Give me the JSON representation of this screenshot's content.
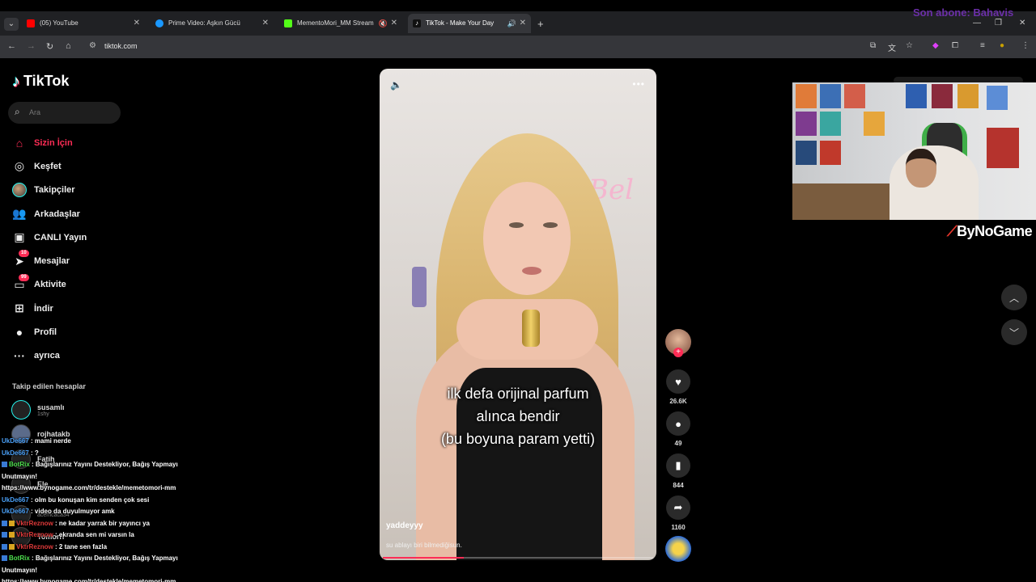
{
  "overlay": {
    "subscriber_text": "Son abone: Bahavis"
  },
  "browser": {
    "tabs": [
      {
        "title": "(05) YouTube",
        "favicon_color": "#ff0000"
      },
      {
        "title": "Prime Video: Aşkın Gücü",
        "favicon_color": "#1a98ff"
      },
      {
        "title": "MementoMori_MM Stream",
        "favicon_color": "#53fc18"
      },
      {
        "title": "TikTok - Make Your Day",
        "favicon_color": "#ffffff"
      }
    ],
    "url": "tiktok.com"
  },
  "tiktok": {
    "logo": "TikTok",
    "search_placeholder": "Ara",
    "nav": [
      {
        "label": "Sizin İçin",
        "icon": "home-icon"
      },
      {
        "label": "Keşfet",
        "icon": "compass-icon"
      },
      {
        "label": "Takipçiler",
        "icon": "avatar-icon"
      },
      {
        "label": "Arkadaşlar",
        "icon": "friends-icon"
      },
      {
        "label": "CANLI Yayın",
        "icon": "live-icon"
      },
      {
        "label": "Mesajlar",
        "icon": "messages-icon",
        "badge": "10"
      },
      {
        "label": "Aktivite",
        "icon": "activity-icon",
        "badge": "99"
      },
      {
        "label": "İndir",
        "icon": "download-icon"
      },
      {
        "label": "Profil",
        "icon": "profile-icon"
      },
      {
        "label": "ayrıca",
        "icon": "more-icon"
      }
    ],
    "following_title": "Takip edilen hesaplar",
    "accounts": [
      {
        "name": "susamlı",
        "sub": "1shy"
      },
      {
        "name": "rojhatakb",
        "sub": ""
      },
      {
        "name": "Fatih",
        "sub": ""
      },
      {
        "name": "Ele",
        "sub": ""
      },
      {
        "name": "",
        "sub": "acemcaca34"
      },
      {
        "name": "Tomorrr",
        "sub": ""
      }
    ],
    "video": {
      "caption_lines": [
        "ilk defa orijinal parfum",
        "alınca bendir",
        "(bu boyuna param yetti)"
      ],
      "username": "yaddeyyy",
      "description": "su ablayı biri bilmediğisun.",
      "progress": 0.3,
      "likes": "26.6K",
      "comments": "49",
      "saves": "844",
      "shares": "1160"
    }
  },
  "chat": [
    {
      "user": "UkDe667",
      "role": "user",
      "text": ": mami nerde"
    },
    {
      "user": "UkDe667",
      "role": "user",
      "text": ": ?"
    },
    {
      "user": "BotRix",
      "role": "bot",
      "text": ": Bağışlarınız Yayını Destekliyor, Bağış Yapmayı Unutmayın! https://www.bynogame.com/tr/destekle/memetomori-mm"
    },
    {
      "user": "UkDe667",
      "role": "user",
      "text": ": olm bu konuşan kim senden çok sesi"
    },
    {
      "user": "UkDe667",
      "role": "user",
      "text": ": video da duyulmuyor amk"
    },
    {
      "user": "VktrReznow",
      "role": "red",
      "text": ": ne kadar yarrak bir yayıncı ya"
    },
    {
      "user": "VktrReznow",
      "role": "red",
      "text": ": ekranda sen mi varsın la"
    },
    {
      "user": "VktrReznow",
      "role": "red",
      "text": ": 2 tane sen fazla"
    },
    {
      "user": "BotRix",
      "role": "bot",
      "text": ": Bağışlarınız Yayını Destekliyor, Bağış Yapmayı Unutmayın! https://www.bynogame.com/tr/destekle/memetomori-mm"
    }
  ],
  "sponsor": "ByNoGame"
}
